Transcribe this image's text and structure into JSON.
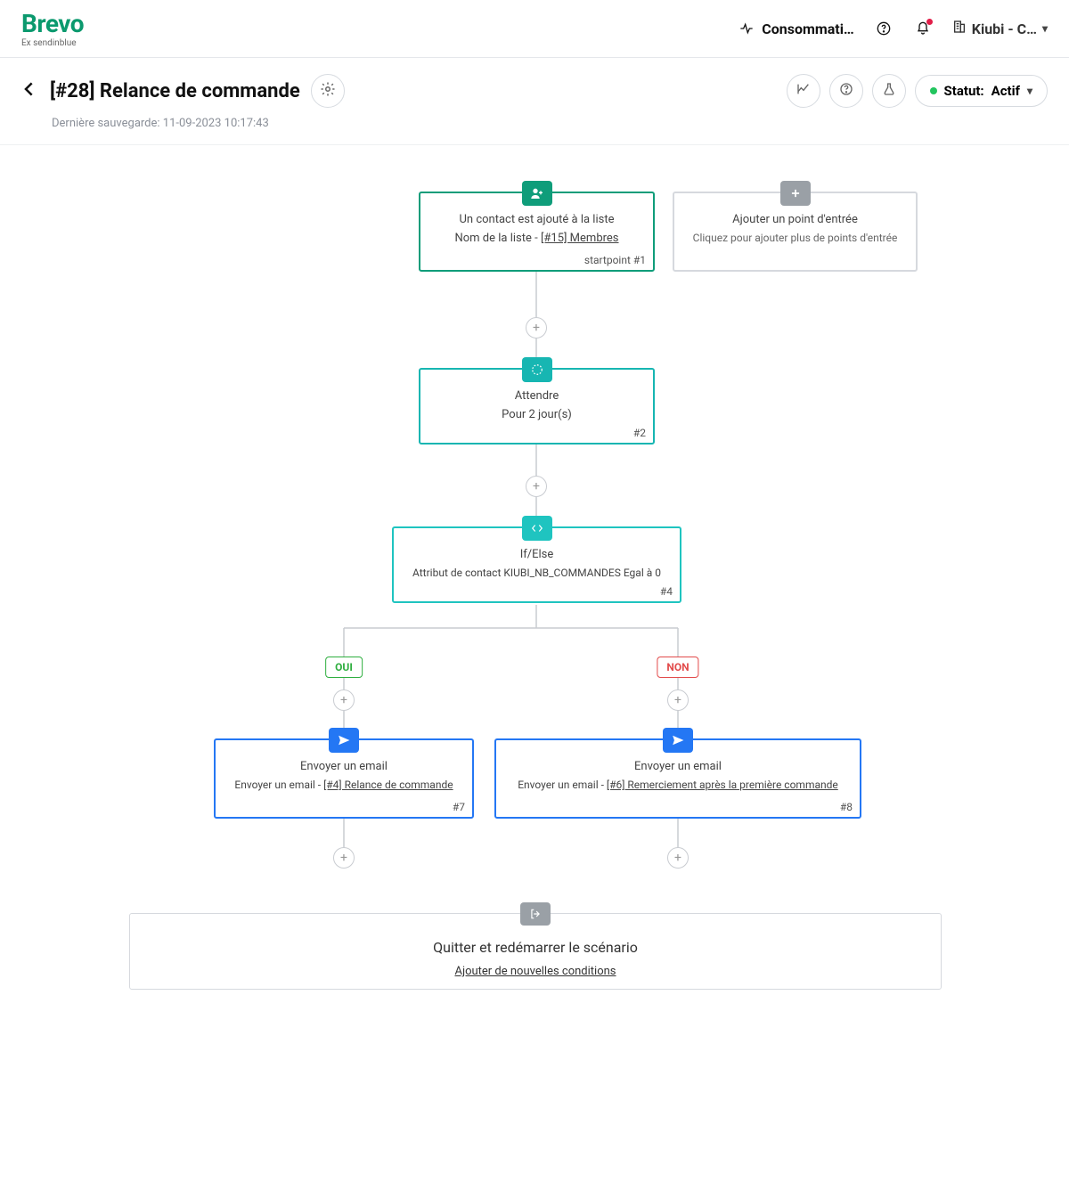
{
  "brand": {
    "name": "Brevo",
    "tagline": "Ex sendinblue"
  },
  "nav": {
    "usage_label": "Consommati…",
    "org_label": "Kiubi - C…"
  },
  "page": {
    "title": "[#28] Relance de commande",
    "last_saved_prefix": "Dernière sauvegarde: ",
    "last_saved_value": "11-09-2023 10:17:43",
    "status_prefix": "Statut: ",
    "status_value": "Actif"
  },
  "entry": {
    "title": "Un contact est ajouté à la liste",
    "list_label": "Nom de la liste - ",
    "list_name": "[#15] Membres",
    "start_label": "startpoint #1"
  },
  "entry_add": {
    "title": "Ajouter un point d'entrée",
    "sub": "Cliquez pour ajouter plus de points d'entrée"
  },
  "wait": {
    "title": "Attendre",
    "detail": "Pour 2 jour(s)",
    "index": "#2"
  },
  "cond": {
    "title": "If/Else",
    "detail": "Attribut de contact KIUBI_NB_COMMANDES Egal à 0",
    "index": "#4",
    "yes": "OUI",
    "no": "NON"
  },
  "email_left": {
    "title": "Envoyer un email",
    "prefix": "Envoyer un email - ",
    "link": "[#4] Relance de commande",
    "index": "#7"
  },
  "email_right": {
    "title": "Envoyer un email",
    "prefix": "Envoyer un email - ",
    "link": "[#6] Remerciement après la première commande",
    "index": "#8"
  },
  "restart": {
    "title": "Quitter et redémarrer le scénario",
    "link": "Ajouter de nouvelles conditions"
  }
}
